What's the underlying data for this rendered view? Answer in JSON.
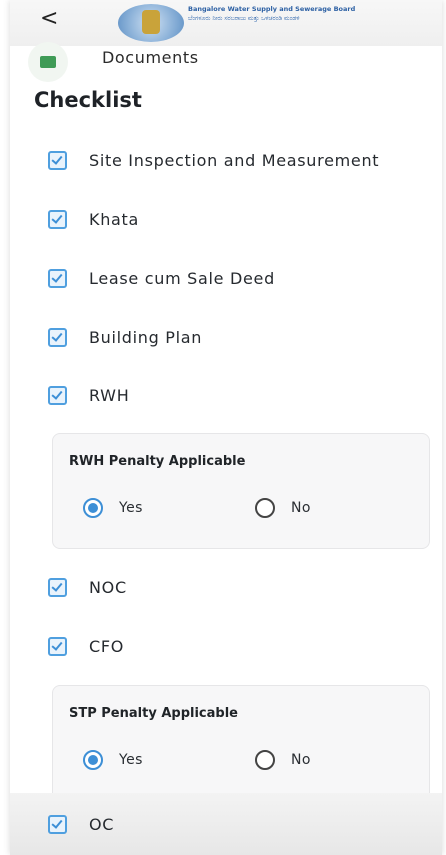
{
  "header": {
    "back_symbol": "<",
    "org_name_en": "Bangalore Water Supply and Sewerage Board",
    "org_name_kn": "ಬೆಂಗಳೂರು ನೀರು ಸರಬರಾಜು ಮತ್ತು ಒಳಚರಂಡಿ ಮಂಡಳಿ"
  },
  "documents_label": "Documents",
  "checklist": {
    "title": "Checklist",
    "items": [
      {
        "label": "Site Inspection and Measurement",
        "checked": true
      },
      {
        "label": "Khata",
        "checked": true
      },
      {
        "label": "Lease cum Sale Deed",
        "checked": true
      },
      {
        "label": "Building Plan",
        "checked": true
      },
      {
        "label": "RWH",
        "checked": true
      },
      {
        "label": "NOC",
        "checked": true
      },
      {
        "label": "CFO",
        "checked": true
      },
      {
        "label": "OC",
        "checked": true
      }
    ]
  },
  "rwh_penalty": {
    "title": "RWH Penalty Applicable",
    "options": [
      {
        "label": "Yes",
        "selected": true
      },
      {
        "label": "No",
        "selected": false
      }
    ]
  },
  "stp_penalty": {
    "title": "STP Penalty Applicable",
    "options": [
      {
        "label": "Yes",
        "selected": true
      },
      {
        "label": "No",
        "selected": false
      }
    ]
  },
  "colors": {
    "accent": "#3d8fd6",
    "checkbox_fill": "#e9f3fc",
    "card_bg": "#f7f7f8"
  }
}
